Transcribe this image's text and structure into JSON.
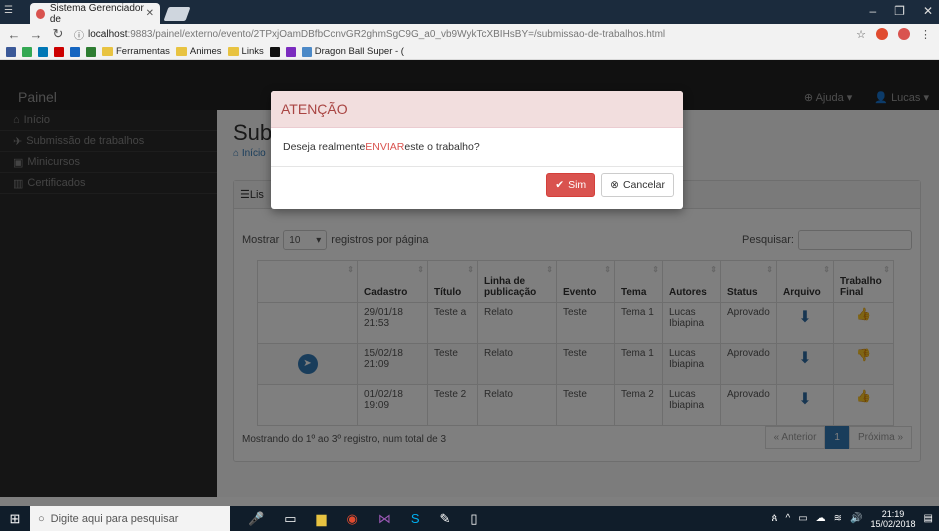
{
  "browser": {
    "tab_title": "Sistema Gerenciador de",
    "url_host": "localhost",
    "url_rest": ":9883/painel/externo/evento/2TPxjOamDBfbCcnvGR2ghmSgC9G_a0_vb9WykTcXBIHsBY=/submissao-de-trabalhos.html",
    "bookmarks": [
      "Ferramentas",
      "Animes",
      "Links",
      "Dragon Ball Super - ("
    ]
  },
  "app": {
    "brand": "Painel",
    "nav_help": "Ajuda",
    "nav_user": "Lucas",
    "sidebar": [
      {
        "label": "Início",
        "icon": "home-icon"
      },
      {
        "label": "Submissão de trabalhos",
        "icon": "paper-plane-icon"
      },
      {
        "label": "Minicursos",
        "icon": "cards-icon"
      },
      {
        "label": "Certificados",
        "icon": "chart-icon"
      }
    ],
    "page_title": "Sub",
    "breadcrumb": "Início",
    "panel_title": "Lis"
  },
  "table": {
    "show_label": "Mostrar",
    "page_size": "10",
    "per_page_label": "registros por página",
    "search_label": "Pesquisar:",
    "headers": [
      "",
      "Cadastro",
      "Título",
      "Linha de publicação",
      "Evento",
      "Tema",
      "Autores",
      "Status",
      "Arquivo",
      "Trabalho Final"
    ],
    "rows": [
      {
        "cadastro": "29/01/18 21:53",
        "titulo": "Teste a",
        "linha": "Relato",
        "evento": "Teste",
        "tema": "Tema 1",
        "autores": "Lucas Ibiapina",
        "status": "Aprovado",
        "final": "up"
      },
      {
        "cadastro": "15/02/18 21:09",
        "titulo": "Teste",
        "linha": "Relato",
        "evento": "Teste",
        "tema": "Tema 1",
        "autores": "Lucas Ibiapina",
        "status": "Aprovado",
        "final": "down"
      },
      {
        "cadastro": "01/02/18 19:09",
        "titulo": "Teste 2",
        "linha": "Relato",
        "evento": "Teste",
        "tema": "Tema 2",
        "autores": "Lucas Ibiapina",
        "status": "Aprovado",
        "final": "up"
      }
    ],
    "info": "Mostrando do 1º ao 3º registro, num total de 3",
    "prev": "« Anterior",
    "page": "1",
    "next": "Próxima »"
  },
  "modal": {
    "title": "ATENÇÃO",
    "body_pre": "Deseja realmente ",
    "body_em": "ENVIAR",
    "body_post": " este o trabalho?",
    "confirm": "Sim",
    "cancel": "Cancelar"
  },
  "taskbar": {
    "search_placeholder": "Digite aqui para pesquisar",
    "time": "21:19",
    "date": "15/02/2018"
  }
}
